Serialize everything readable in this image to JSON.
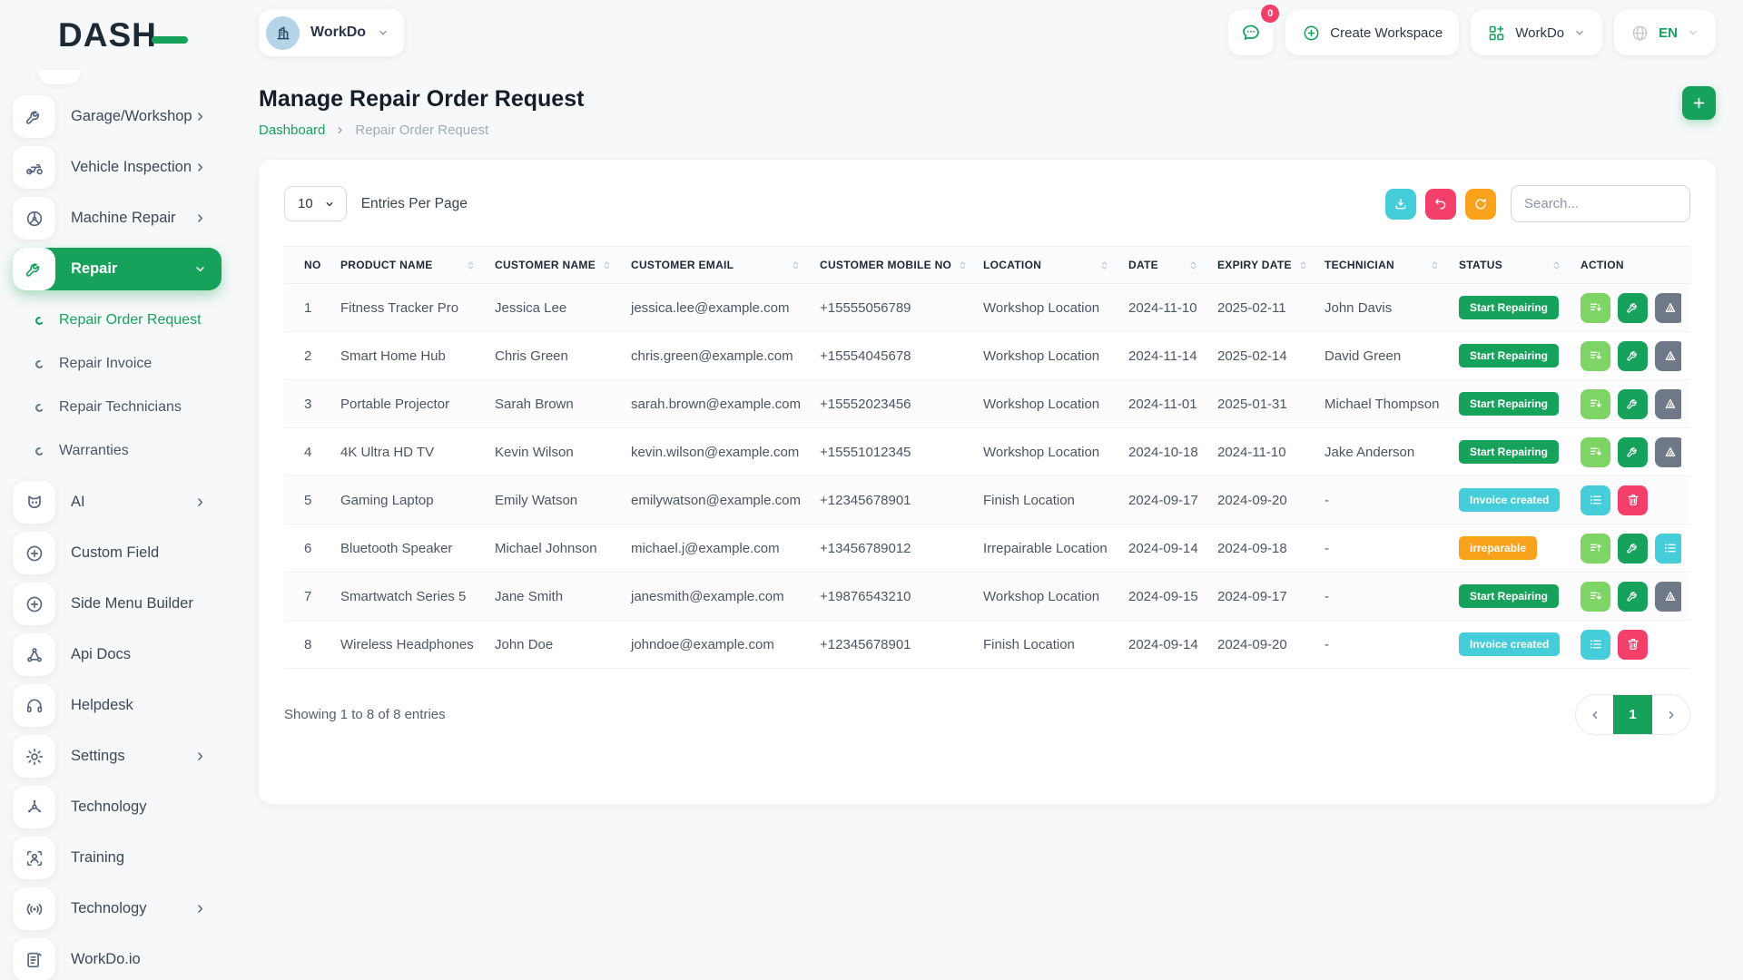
{
  "brand": {
    "logo_text": "DASH"
  },
  "colors": {
    "accent_green": "#17a25b",
    "light_green": "#7ed464",
    "cyan": "#45ced9",
    "pink": "#f43f6b",
    "orange": "#fba21d",
    "gray": "#6f7886"
  },
  "topbar": {
    "workspace": {
      "name": "WorkDo",
      "avatar_icon": "building-icon"
    },
    "chat_badge": "0",
    "create_workspace_label": "Create Workspace",
    "workdo_menu_label": "WorkDo",
    "language": "EN"
  },
  "sidebar": {
    "items": [
      {
        "label": "Garage/Workshop",
        "icon": "wrench-icon",
        "chevron": "right"
      },
      {
        "label": "Vehicle Inspection",
        "icon": "motorcycle-icon",
        "chevron": "right"
      },
      {
        "label": "Machine Repair",
        "icon": "machine-repair-icon",
        "chevron": "right"
      },
      {
        "label": "Repair",
        "icon": "wrench-icon",
        "chevron": "down",
        "active": true,
        "children": [
          {
            "label": "Repair Order Request",
            "active": true
          },
          {
            "label": "Repair Invoice"
          },
          {
            "label": "Repair Technicians"
          },
          {
            "label": "Warranties"
          }
        ]
      },
      {
        "label": "AI",
        "icon": "ai-icon",
        "chevron": "right"
      },
      {
        "label": "Custom Field",
        "icon": "plus-circle-icon"
      },
      {
        "label": "Side Menu Builder",
        "icon": "plus-circle-icon"
      },
      {
        "label": "Api Docs",
        "icon": "api-docs-icon"
      },
      {
        "label": "Helpdesk",
        "icon": "headset-icon"
      },
      {
        "label": "Settings",
        "icon": "gear-icon",
        "chevron": "right"
      },
      {
        "label": "Technology",
        "icon": "hub-icon"
      },
      {
        "label": "Training",
        "icon": "training-icon"
      },
      {
        "label": "Technology",
        "icon": "broadcast-icon",
        "chevron": "right"
      },
      {
        "label": "WorkDo.io",
        "icon": "document-icon"
      }
    ]
  },
  "page": {
    "title": "Manage Repair Order Request",
    "breadcrumb": [
      "Dashboard",
      "Repair Order Request"
    ]
  },
  "controls": {
    "entries_value": "10",
    "entries_label": "Entries Per Page",
    "search_placeholder": "Search...",
    "buttons": [
      {
        "name": "export",
        "icon": "download-icon",
        "color": "cyan"
      },
      {
        "name": "undo",
        "icon": "undo-icon",
        "color": "pink"
      },
      {
        "name": "refresh",
        "icon": "refresh-icon",
        "color": "orange"
      }
    ]
  },
  "table": {
    "columns": [
      {
        "label": "NO",
        "sortable": false
      },
      {
        "label": "PRODUCT NAME",
        "sortable": true
      },
      {
        "label": "CUSTOMER NAME",
        "sortable": true
      },
      {
        "label": "CUSTOMER EMAIL",
        "sortable": true
      },
      {
        "label": "CUSTOMER MOBILE NO",
        "sortable": true
      },
      {
        "label": "LOCATION",
        "sortable": true
      },
      {
        "label": "DATE",
        "sortable": true
      },
      {
        "label": "EXPIRY DATE",
        "sortable": true
      },
      {
        "label": "TECHNICIAN",
        "sortable": true
      },
      {
        "label": "STATUS",
        "sortable": true
      },
      {
        "label": "ACTION",
        "sortable": false
      }
    ],
    "rows": [
      {
        "no": "1",
        "product": "Fitness Tracker Pro",
        "customer": "Jessica Lee",
        "email": "jessica.lee@example.com",
        "mobile": "+15555056789",
        "location": "Workshop Location",
        "date": "2024-11-10",
        "expiry": "2025-02-11",
        "technician": "John Davis",
        "status": {
          "label": "Start Repairing",
          "color": "green"
        },
        "actions": [
          {
            "icon": "sort-down-icon",
            "color": "lightgreen"
          },
          {
            "icon": "wrench-icon",
            "color": "green"
          },
          {
            "icon": "signal-icon",
            "color": "gray"
          },
          {
            "icon": "receipt-icon",
            "color": "pink"
          }
        ]
      },
      {
        "no": "2",
        "product": "Smart Home Hub",
        "customer": "Chris Green",
        "email": "chris.green@example.com",
        "mobile": "+15554045678",
        "location": "Workshop Location",
        "date": "2024-11-14",
        "expiry": "2025-02-14",
        "technician": "David Green",
        "status": {
          "label": "Start Repairing",
          "color": "green"
        },
        "actions": [
          {
            "icon": "sort-down-icon",
            "color": "lightgreen"
          },
          {
            "icon": "wrench-icon",
            "color": "green"
          },
          {
            "icon": "signal-icon",
            "color": "gray"
          },
          {
            "icon": "receipt-icon",
            "color": "pink"
          }
        ]
      },
      {
        "no": "3",
        "product": "Portable Projector",
        "customer": "Sarah Brown",
        "email": "sarah.brown@example.com",
        "mobile": "+15552023456",
        "location": "Workshop Location",
        "date": "2024-11-01",
        "expiry": "2025-01-31",
        "technician": "Michael Thompson",
        "status": {
          "label": "Start Repairing",
          "color": "green"
        },
        "actions": [
          {
            "icon": "sort-down-icon",
            "color": "lightgreen"
          },
          {
            "icon": "wrench-icon",
            "color": "green"
          },
          {
            "icon": "signal-icon",
            "color": "gray"
          },
          {
            "icon": "receipt-icon",
            "color": "pink"
          }
        ]
      },
      {
        "no": "4",
        "product": "4K Ultra HD TV",
        "customer": "Kevin Wilson",
        "email": "kevin.wilson@example.com",
        "mobile": "+15551012345",
        "location": "Workshop Location",
        "date": "2024-10-18",
        "expiry": "2024-11-10",
        "technician": "Jake Anderson",
        "status": {
          "label": "Start Repairing",
          "color": "green"
        },
        "actions": [
          {
            "icon": "sort-down-icon",
            "color": "lightgreen"
          },
          {
            "icon": "wrench-icon",
            "color": "green"
          },
          {
            "icon": "signal-icon",
            "color": "gray"
          },
          {
            "icon": "receipt-icon",
            "color": "pink"
          }
        ]
      },
      {
        "no": "5",
        "product": "Gaming Laptop",
        "customer": "Emily Watson",
        "email": "emilywatson@example.com",
        "mobile": "+12345678901",
        "location": "Finish Location",
        "date": "2024-09-17",
        "expiry": "2024-09-20",
        "technician": "-",
        "status": {
          "label": "Invoice created",
          "color": "cyan"
        },
        "actions": [
          {
            "icon": "list-icon",
            "color": "cyan"
          },
          {
            "icon": "trash-icon",
            "color": "pink"
          }
        ]
      },
      {
        "no": "6",
        "product": "Bluetooth Speaker",
        "customer": "Michael Johnson",
        "email": "michael.j@example.com",
        "mobile": "+13456789012",
        "location": "Irrepairable Location",
        "date": "2024-09-14",
        "expiry": "2024-09-18",
        "technician": "-",
        "status": {
          "label": "irreparable",
          "color": "orange"
        },
        "actions": [
          {
            "icon": "sort-up-icon",
            "color": "lightgreen"
          },
          {
            "icon": "wrench-icon",
            "color": "green"
          },
          {
            "icon": "list-icon",
            "color": "cyan"
          },
          {
            "icon": "receipt-icon",
            "color": "pink"
          }
        ]
      },
      {
        "no": "7",
        "product": "Smartwatch Series 5",
        "customer": "Jane Smith",
        "email": "janesmith@example.com",
        "mobile": "+19876543210",
        "location": "Workshop Location",
        "date": "2024-09-15",
        "expiry": "2024-09-17",
        "technician": "-",
        "status": {
          "label": "Start Repairing",
          "color": "green"
        },
        "actions": [
          {
            "icon": "sort-down-icon",
            "color": "lightgreen"
          },
          {
            "icon": "wrench-icon",
            "color": "green"
          },
          {
            "icon": "signal-icon",
            "color": "gray"
          },
          {
            "icon": "receipt-icon",
            "color": "pink"
          }
        ]
      },
      {
        "no": "8",
        "product": "Wireless Headphones",
        "customer": "John Doe",
        "email": "johndoe@example.com",
        "mobile": "+12345678901",
        "location": "Finish Location",
        "date": "2024-09-14",
        "expiry": "2024-09-20",
        "technician": "-",
        "status": {
          "label": "Invoice created",
          "color": "cyan"
        },
        "actions": [
          {
            "icon": "list-icon",
            "color": "cyan"
          },
          {
            "icon": "trash-icon",
            "color": "pink"
          }
        ]
      }
    ]
  },
  "footer": {
    "summary": "Showing 1 to 8 of 8 entries",
    "pagination": {
      "prev_icon": "chevron-left-icon",
      "current": "1",
      "next_icon": "chevron-right-icon"
    }
  }
}
